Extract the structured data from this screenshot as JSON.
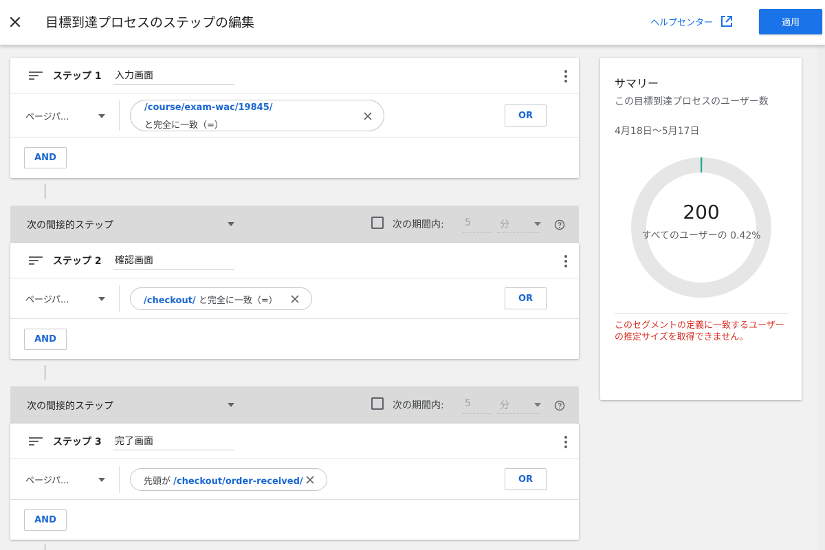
{
  "header": {
    "title": "目標到達プロセスのステップの編集",
    "help_label": "ヘルプセンター",
    "apply_label": "適用"
  },
  "steps": [
    {
      "label": "ステップ 1",
      "name": "入力画面",
      "dimension": "ページパ...",
      "condition": {
        "value": "/course/exam-wac/19845/",
        "match": "と完全に一致（=）"
      },
      "or_label": "OR",
      "and_label": "AND"
    },
    {
      "label": "ステップ 2",
      "name": "確認画面",
      "dimension": "ページパ...",
      "condition": {
        "value": "/checkout/",
        "match": "と完全に一致（=）"
      },
      "or_label": "OR",
      "and_label": "AND"
    },
    {
      "label": "ステップ 3",
      "name": "完了画面",
      "dimension": "ページパ...",
      "condition": {
        "prefix": "先頭が",
        "value": "/checkout/order-received/"
      },
      "or_label": "OR",
      "and_label": "AND"
    }
  ],
  "between": [
    {
      "label": "次の間接的ステップ",
      "period_label": "次の期間内:",
      "period_value": "5",
      "period_unit": "分"
    },
    {
      "label": "次の間接的ステップ",
      "period_label": "次の期間内:",
      "period_value": "5",
      "period_unit": "分"
    }
  ],
  "summary": {
    "title": "サマリー",
    "description": "この目標到達プロセスのユーザー数",
    "date_range": "4月18日〜5月17日",
    "count": "200",
    "percent_text": "すべてのユーザーの 0.42%",
    "percent_value": 0.42,
    "error": "このセグメントの定義に一致するユーザーの推定サイズを取得できません。"
  },
  "colors": {
    "primary": "#1a73e8",
    "link": "#1967d2",
    "error": "#d93025",
    "donut_track": "#e6e6e6",
    "donut_fill": "#1aa896"
  },
  "icons": {
    "close": "close-icon",
    "open_in_new": "open-in-new-icon",
    "drag": "drag-handle-icon",
    "menu": "more-vert-icon",
    "dropdown": "dropdown-arrow-icon",
    "clear": "clear-icon",
    "help": "help-icon"
  }
}
